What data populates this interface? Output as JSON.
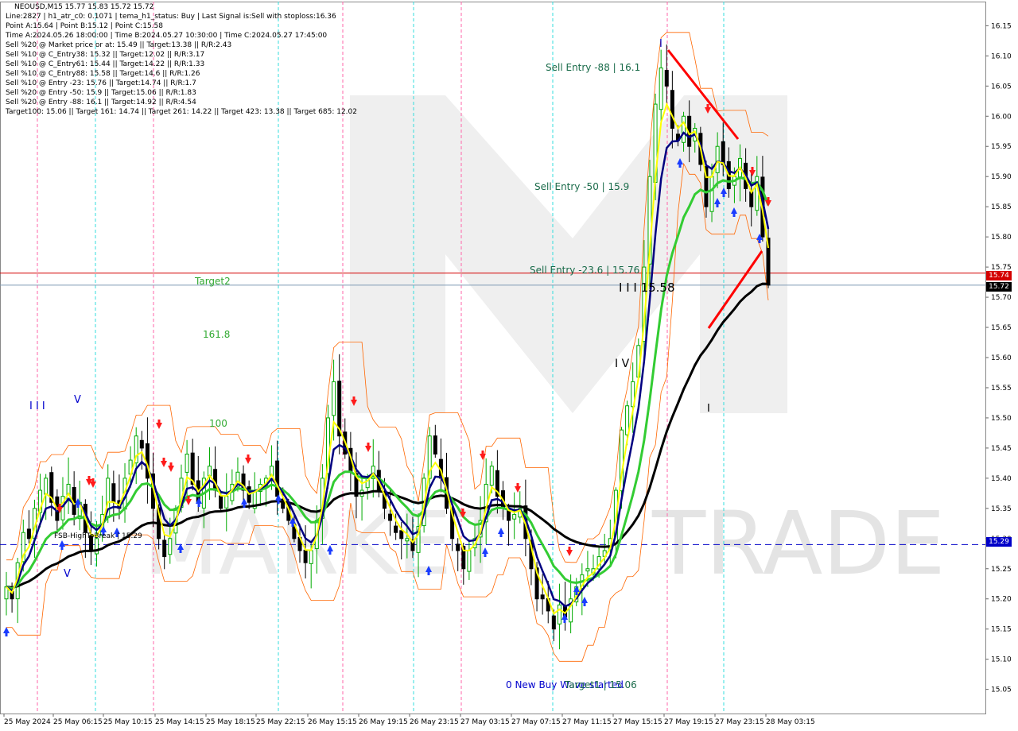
{
  "window_title": "NEOUSD,M15  15.77 15.83 15.72 15.72",
  "info_lines": [
    "Line:2827 | h1_atr_c0: 0.1071 | tema_h1_status: Buy | Last Signal is:Sell with stoploss:16.36",
    "Point A:15.64 | Point B:15.12 | Point C:15.58",
    "Time A:2024.05.26 18:00:00 | Time B:2024.05.27 10:30:00 | Time C:2024.05.27 17:45:00",
    "Sell %20 @ Market price or at: 15.49 || Target:13.38 || R/R:2.43",
    "Sell %10 @ C_Entry38: 15.32 || Target:12.02 || R/R:3.17",
    "Sell %10 @ C_Entry61: 15.44 || Target:14.22 || R/R:1.33",
    "Sell %10 @ C_Entry88: 15.58 || Target:14.6 || R/R:1.26",
    "Sell %10 @ Entry -23: 15.76 || Target:14.74 || R/R:1.7",
    "Sell %20 @ Entry -50: 15.9 || Target:15.06 || R/R:1.83",
    "Sell %20 @ Entry -88: 16.1 || Target:14.92 || R/R:4.54",
    "Target100: 15.06 || Target 161: 14.74 || Target 261: 14.22 || Target 423: 13.38 || Target 685: 12.02"
  ],
  "annotations": {
    "sell_entry_88": "Sell Entry -88 | 16.1",
    "sell_entry_50": "Sell Entry -50 | 15.9",
    "sell_entry_23": "Sell Entry -23.6 | 15.76",
    "target2": "Target2",
    "fib_1618": "161.8",
    "fib_100": "100",
    "wave_iii_c": "I I I 15.58",
    "wave_iv": "I V",
    "wave_iii_left": "I I I",
    "wave_v_left": "V",
    "wave_v_left2": "V",
    "wave_i_top": "I",
    "wave_i_mid": "I",
    "fsb_label": "FSB-HighToBreak | 15.29",
    "buy_wave_label": "0 New Buy Wave started",
    "target_label": "Target1 | 15.06",
    "watermark_trade": "TRADE",
    "watermark_mark": "MARKET"
  },
  "price_labels": {
    "red_line": "15.74",
    "current": "15.72",
    "blue_line": "15.29"
  },
  "colors": {
    "red_line": "#d40000",
    "blue_dashed": "#0000c8",
    "current_line": "#7f9bb5",
    "yellow": "#ffff00",
    "green": "#33cc33",
    "navy": "#000080",
    "black_ma": "#000000",
    "candle_up": "#00aa00",
    "candle_down": "#000000",
    "magenta_vline": "#ff66aa",
    "cyan_vline": "#33dddd",
    "orange_env": "#ff6600"
  },
  "chart_data": {
    "type": "candlestick",
    "symbol": "NEOUSD",
    "timeframe": "M15",
    "ohlc_current": {
      "open": 15.77,
      "high": 15.83,
      "low": 15.72,
      "close": 15.72
    },
    "ylim": [
      15.01,
      16.19
    ],
    "y_ticks": [
      15.05,
      15.1,
      15.15,
      15.2,
      15.25,
      15.3,
      15.35,
      15.4,
      15.45,
      15.5,
      15.55,
      15.6,
      15.65,
      15.7,
      15.75,
      15.8,
      15.85,
      15.9,
      15.95,
      16.0,
      16.05,
      16.1,
      16.15
    ],
    "x_tick_labels": [
      "25 May 2024",
      "25 May 06:15",
      "25 May 10:15",
      "25 May 14:15",
      "25 May 18:15",
      "25 May 22:15",
      "26 May 15:15",
      "26 May 19:15",
      "26 May 23:15",
      "27 May 03:15",
      "27 May 07:15",
      "27 May 11:15",
      "27 May 15:15",
      "27 May 19:15",
      "27 May 23:15",
      "28 May 03:15"
    ],
    "horizontal_lines": [
      {
        "label": "15.74",
        "value": 15.74,
        "color": "#d40000",
        "style": "solid"
      },
      {
        "label": "15.72",
        "value": 15.72,
        "color": "#7f9bb5",
        "style": "solid"
      },
      {
        "label": "15.29",
        "value": 15.29,
        "color": "#0000c8",
        "style": "dashed"
      }
    ],
    "closes": [
      15.22,
      15.2,
      15.26,
      15.31,
      15.3,
      15.35,
      15.38,
      15.4,
      15.36,
      15.33,
      15.37,
      15.39,
      15.34,
      15.36,
      15.31,
      15.28,
      15.3,
      15.34,
      15.4,
      15.36,
      15.35,
      15.4,
      15.43,
      15.47,
      15.45,
      15.4,
      15.35,
      15.3,
      15.27,
      15.3,
      15.35,
      15.4,
      15.44,
      15.39,
      15.36,
      15.4,
      15.42,
      15.38,
      15.35,
      15.37,
      15.39,
      15.41,
      15.38,
      15.36,
      15.38,
      15.39,
      15.4,
      15.42,
      15.37,
      15.35,
      15.33,
      15.3,
      15.28,
      15.26,
      15.28,
      15.33,
      15.4,
      15.5,
      15.56,
      15.47,
      15.44,
      15.41,
      15.37,
      15.38,
      15.4,
      15.42,
      15.38,
      15.35,
      15.33,
      15.31,
      15.3,
      15.3,
      15.28,
      15.32,
      15.4,
      15.47,
      15.44,
      15.4,
      15.35,
      15.3,
      15.28,
      15.25,
      15.28,
      15.3,
      15.33,
      15.39,
      15.42,
      15.37,
      15.35,
      15.33,
      15.34,
      15.35,
      15.3,
      15.25,
      15.2,
      15.2,
      15.18,
      15.15,
      15.19,
      15.17,
      15.2,
      15.22,
      15.24,
      15.25,
      15.25,
      15.27,
      15.28,
      15.3,
      15.38,
      15.48,
      15.52,
      15.56,
      15.62,
      15.75,
      15.9,
      16.02,
      16.08,
      16.05,
      15.98,
      15.96,
      16.0,
      15.95,
      15.98,
      15.92,
      15.85,
      15.9,
      15.95,
      15.92,
      15.88,
      15.9,
      15.93,
      15.88,
      15.85,
      15.9,
      15.8,
      15.72
    ],
    "series": [
      {
        "name": "",
        "color": "#000000"
      },
      {
        "name": "",
        "color": "#33cc33"
      },
      {
        "name": "",
        "color": "#000080"
      },
      {
        "name": "",
        "color": "#ffff00"
      }
    ]
  }
}
